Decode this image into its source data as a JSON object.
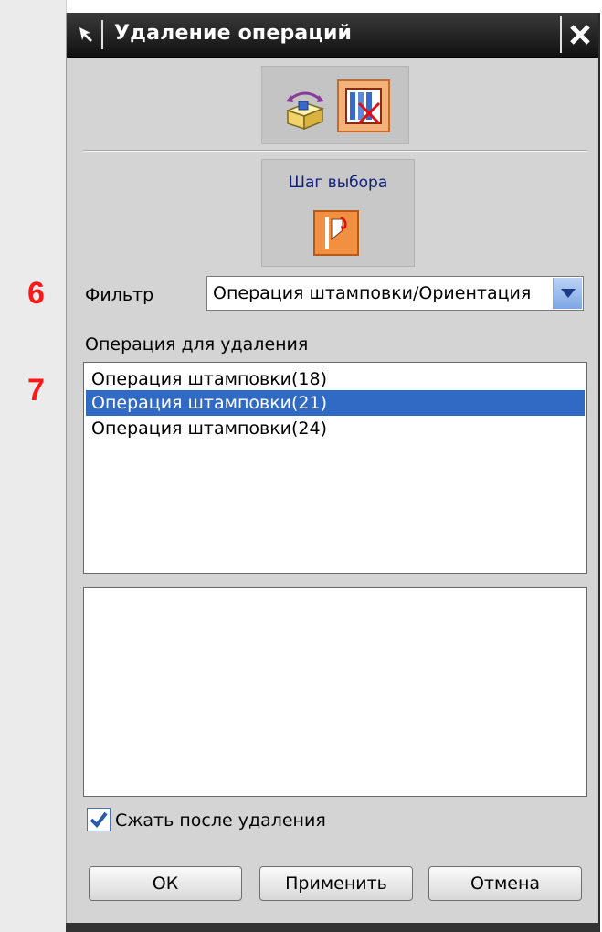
{
  "window": {
    "title": "Удаление операций"
  },
  "ops_type": {
    "buttons": [
      "operations-group-icon",
      "delete-operation-icon"
    ]
  },
  "selection_step": {
    "label": "Шаг выбора",
    "icon": "select-stamp-icon"
  },
  "annotations": {
    "marker_filter": "6",
    "marker_list": "7"
  },
  "filter": {
    "label": "Фильтр",
    "value": "Операция штамповки/Ориентация"
  },
  "operations_list": {
    "label": "Операция для удаления",
    "items": [
      {
        "text": "Операция штамповки(18)",
        "selected": false
      },
      {
        "text": "Операция штамповки(21)",
        "selected": true
      },
      {
        "text": "Операция штамповки(24)",
        "selected": false
      }
    ]
  },
  "compress": {
    "label": "Сжать после удаления",
    "checked": true
  },
  "buttons": {
    "ok": "ОК",
    "apply": "Применить",
    "cancel": "Отмена"
  },
  "colors": {
    "accent": "#316ac5",
    "marker": "#ff1a1a",
    "titlebar": "#1c1c1c"
  }
}
